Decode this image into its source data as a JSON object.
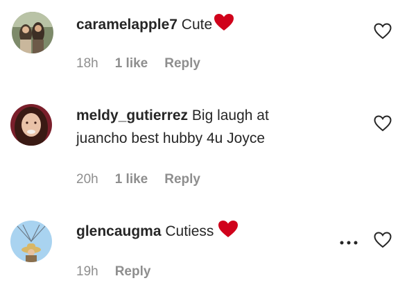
{
  "comments": [
    {
      "username": "caramelapple7",
      "text": "Cute",
      "time": "18h",
      "likes": "1 like",
      "reply": "Reply"
    },
    {
      "username": "meldy_gutierrez",
      "text_line1": "Big laugh at",
      "text_line2": "juancho best hubby 4u Joyce",
      "time": "20h",
      "likes": "1 like",
      "reply": "Reply"
    },
    {
      "username": "glencaugma",
      "text": "Cutiess",
      "time": "19h",
      "reply": "Reply"
    }
  ],
  "icons": {
    "heart_emoji": "red-heart-emoji",
    "like": "heart-outline-icon",
    "more": "more-options-icon"
  },
  "colors": {
    "text": "#262626",
    "meta": "#8e8e8e",
    "heart": "#d0021b"
  }
}
